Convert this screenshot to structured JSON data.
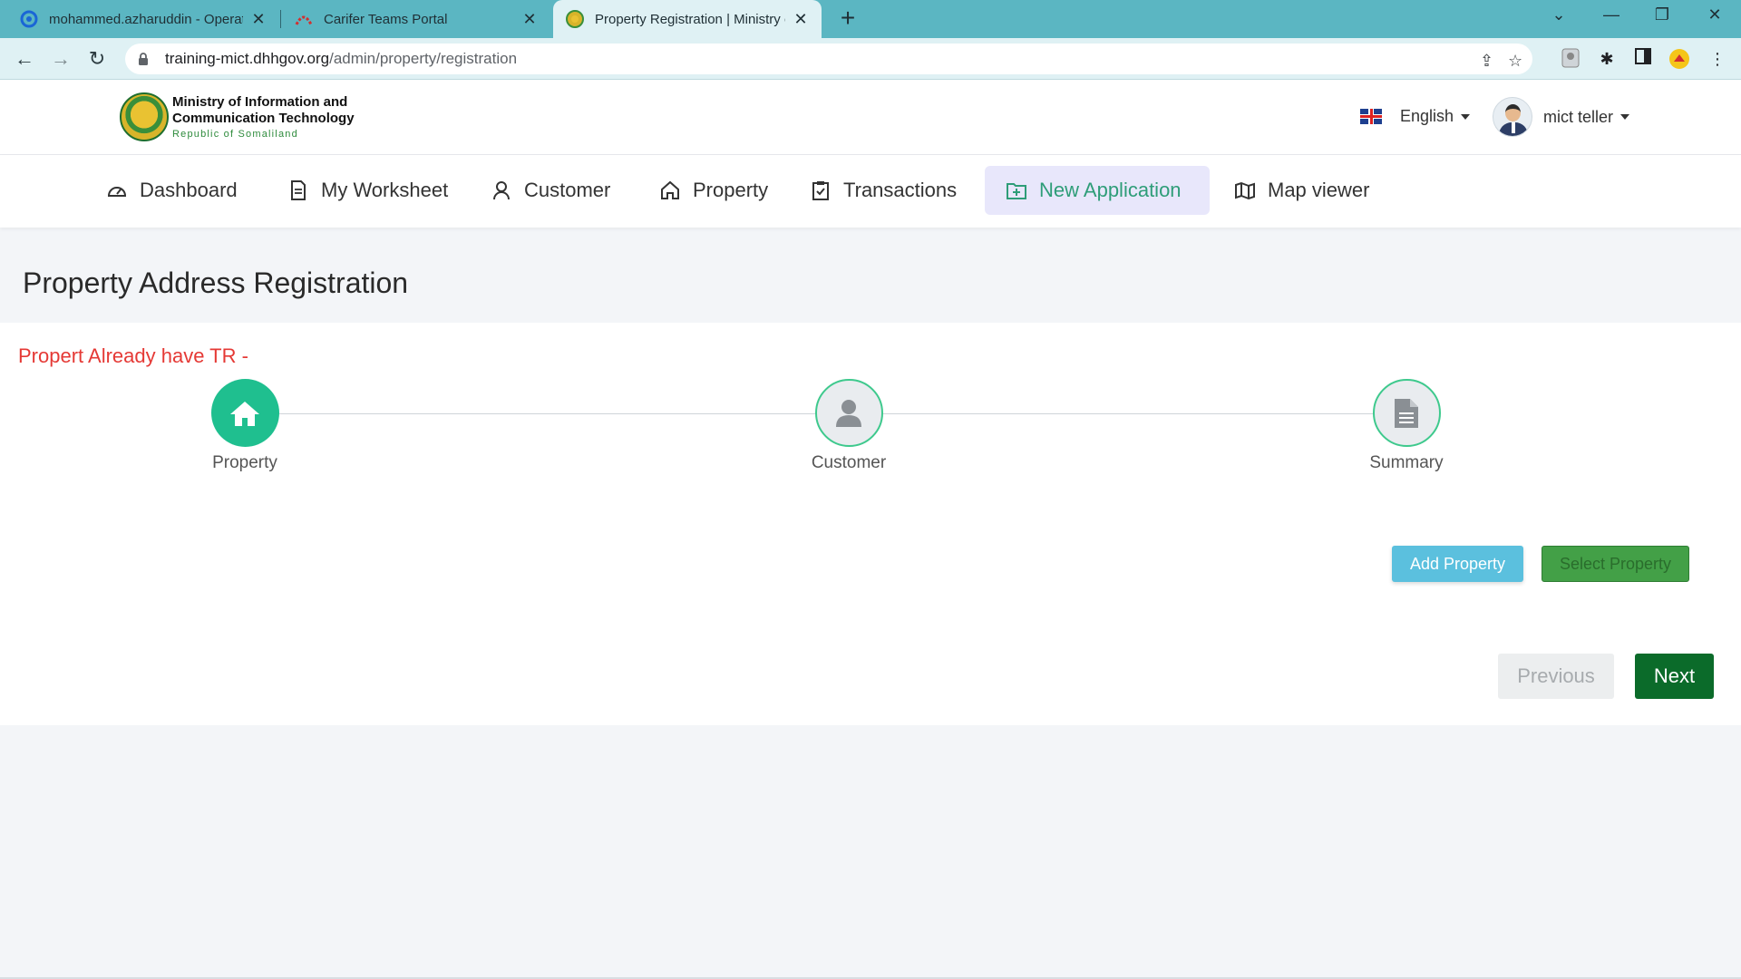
{
  "browser": {
    "tabs": [
      {
        "title": "mohammed.azharuddin - Operat",
        "icon": "operations-favicon"
      },
      {
        "title": "Carifer Teams Portal",
        "icon": "carifer-favicon"
      },
      {
        "title": "Property Registration | Ministry o",
        "icon": "ministry-seal-favicon",
        "active": true
      }
    ],
    "url_host": "training-mict.dhhgov.org",
    "url_path": "/admin/property/registration"
  },
  "header": {
    "logo_line1": "Ministry of Information  and",
    "logo_line2": "Communication Technology",
    "logo_line3": "Republic of Somaliland",
    "language": "English",
    "user_name": "mict teller"
  },
  "nav": [
    {
      "label": "Dashboard",
      "icon": "gauge-icon"
    },
    {
      "label": "My Worksheet",
      "icon": "document-icon"
    },
    {
      "label": "Customer",
      "icon": "user-icon"
    },
    {
      "label": "Property",
      "icon": "home-icon"
    },
    {
      "label": "Transactions",
      "icon": "clipboard-check-icon"
    },
    {
      "label": "New Application",
      "icon": "folder-plus-icon",
      "active": true
    },
    {
      "label": "Map viewer",
      "icon": "map-icon"
    }
  ],
  "page": {
    "title": "Property Address Registration",
    "warning": "Propert Already have TR -",
    "steps": [
      {
        "label": "Property",
        "icon": "home-icon",
        "state": "done"
      },
      {
        "label": "Customer",
        "icon": "user-icon",
        "state": "pending"
      },
      {
        "label": "Summary",
        "icon": "document-icon",
        "state": "pending"
      }
    ],
    "add_property_label": "Add Property",
    "select_property_label": "Select Property",
    "previous_label": "Previous",
    "next_label": "Next"
  },
  "colors": {
    "tabbar": "#5bb6c2",
    "accent_green": "#1fbf8f",
    "nav_active_bg": "#e8e7fb",
    "warning_red": "#e53935",
    "next_button": "#0b6b2a"
  }
}
